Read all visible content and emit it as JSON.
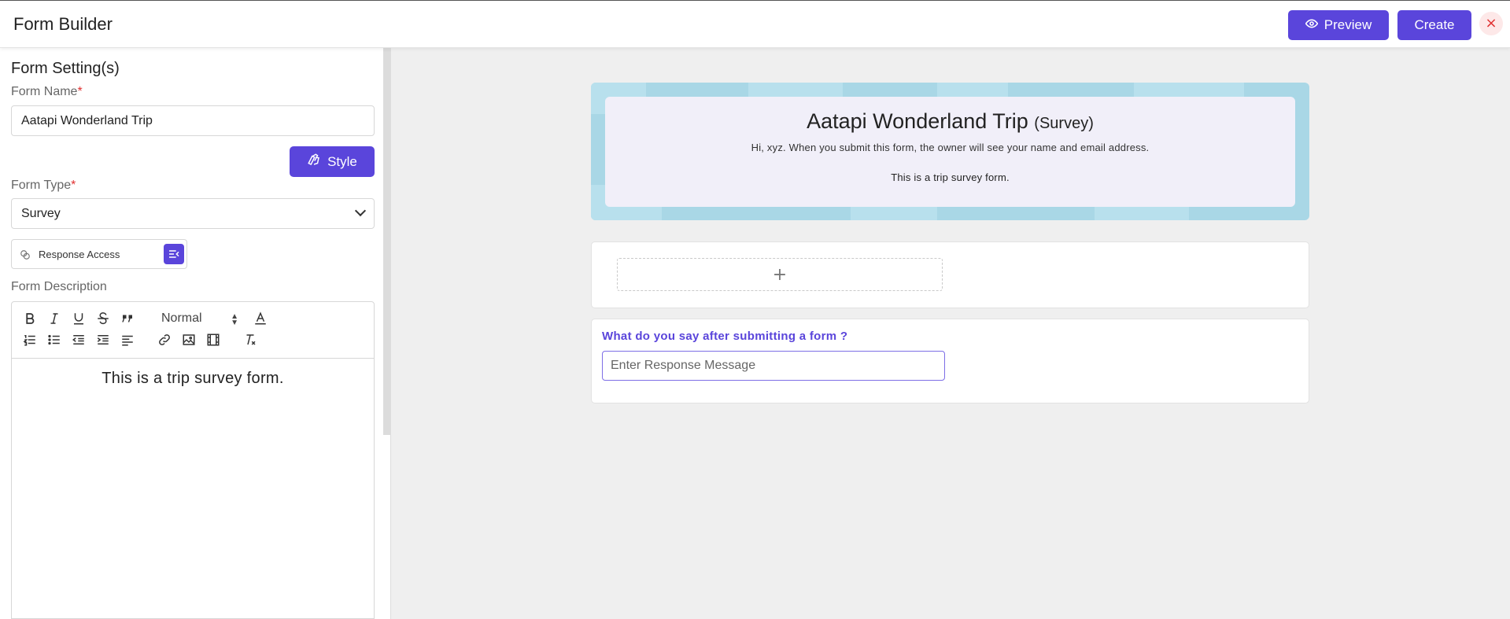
{
  "header": {
    "title": "Form Builder",
    "preview_label": "Preview",
    "create_label": "Create",
    "close_glyph": "×"
  },
  "sidebar": {
    "heading": "Form Setting(s)",
    "form_name_label": "Form Name",
    "form_name_value": "Aatapi Wonderland Trip",
    "style_label": "Style",
    "form_type_label": "Form Type",
    "form_type_value": "Survey",
    "response_access_label": "Response Access",
    "form_description_label": "Form Description",
    "required_marker": "*",
    "editor": {
      "heading_select": "Normal",
      "content": "This is a trip survey form."
    }
  },
  "preview": {
    "title": "Aatapi Wonderland Trip",
    "type_suffix": "(Survey)",
    "notice": "Hi, xyz. When you submit this form, the owner will see your name and email address.",
    "description": "This is a trip survey form.",
    "add_glyph": "+",
    "response_question": "What do you say after submitting a form ?",
    "response_placeholder": "Enter Response Message"
  },
  "colors": {
    "accent": "#5a45db",
    "close_bg": "#fde8e8",
    "close_fg": "#e03131",
    "banner": "#a9d7e6",
    "banner_card": "#f1eff9"
  }
}
